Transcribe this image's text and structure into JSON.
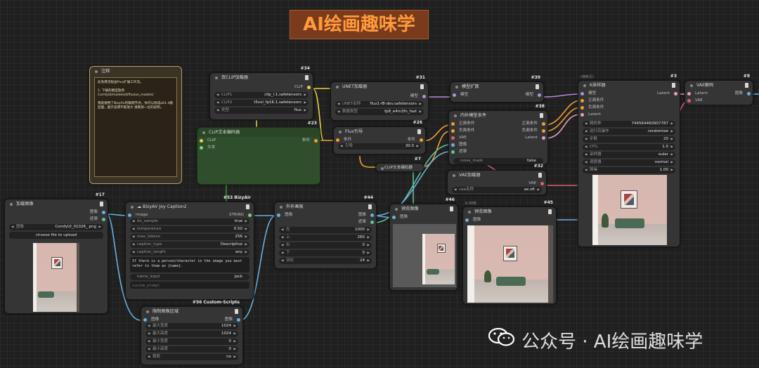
{
  "banner": {
    "title": "AI绘画趣味学"
  },
  "watermark": {
    "text": "公众号 · AI绘画趣味学"
  },
  "note": {
    "title": "注释",
    "lines": [
      "此免费流程由Flux扩展工作流。",
      "1. 下载的模型放到",
      "ComfyUI/models/diffusion_models/",
      "我就要用了BizyAir的联网节点，你可以改成a01.4模",
      "型图，图示说明不能放大 请看测一位的说明。"
    ]
  },
  "dual_clip": {
    "title": "双CLIP加载器",
    "id": "#34",
    "out": "CLIP",
    "w": [
      {
        "k": "CLIP1",
        "v": "clip_l.1.safetensors"
      },
      {
        "k": "CLIP2",
        "v": "t5xxl_fp16.1.safetensors"
      },
      {
        "k": "类型",
        "v": "flux"
      }
    ]
  },
  "unet": {
    "title": "UNET加载器",
    "id": "#31",
    "out": "模型",
    "w": [
      {
        "k": "UNET名称",
        "v": "flux1-f8-dev.safetensors"
      },
      {
        "k": "数据类型",
        "v": "fp8_e4m3fn_fast"
      }
    ]
  },
  "model_sampler": {
    "title": "模型扩散",
    "id": "#39",
    "in": "模型",
    "out": "模型"
  },
  "inpaint_cond": {
    "title": "内补模型条件",
    "id": "#38",
    "ins": [
      "正面条件",
      "负面条件",
      "VAE",
      "图像",
      "遮罩"
    ],
    "outs": [
      "正面条件",
      "负面条件",
      "Latent"
    ],
    "w": [
      {
        "k": "noise_mask",
        "v": "false"
      }
    ]
  },
  "ksampler": {
    "title": "K采样器",
    "id": "#3",
    "label_above": "(待执行)",
    "ins": [
      "模型",
      "正面条件",
      "负面条件",
      "Latent"
    ],
    "out": "Latent",
    "w": [
      {
        "k": "随机种",
        "v": "744564460907787"
      },
      {
        "k": "运行后操作",
        "v": "randomize"
      },
      {
        "k": "步数",
        "v": "20"
      },
      {
        "k": "CFG",
        "v": "1.0"
      },
      {
        "k": "采样器",
        "v": "euler"
      },
      {
        "k": "调度器",
        "v": "normal"
      },
      {
        "k": "降噪",
        "v": "1.00"
      }
    ]
  },
  "vae_decode": {
    "title": "VAE解码",
    "id": "#8",
    "ins": [
      "Latent",
      "VAE"
    ],
    "out": "图像"
  },
  "clip_encode": {
    "title": "CLIP文本编码器",
    "id": "#23",
    "ins": [
      "CLIP",
      "文本"
    ],
    "out": "条件"
  },
  "flux_guide": {
    "title": "Flux引导",
    "id": "#26",
    "in": "条件",
    "out": "条件",
    "w": [
      {
        "k": "引导",
        "v": "30.0"
      }
    ]
  },
  "clip_encode2": {
    "title": "CLIP文本编码器",
    "id": "#7"
  },
  "vae_loader": {
    "title": "VAE加载器",
    "id": "#32",
    "out": "VAE",
    "w": [
      {
        "k": "vae名称",
        "v": "ae.sft"
      }
    ]
  },
  "load_image": {
    "title": "加载图像",
    "id": "#17",
    "outs": [
      "图像",
      "遮罩"
    ],
    "w": [
      {
        "k": "图像",
        "v": "ComfyUI_01026_.png"
      }
    ],
    "upload": "choose file to upload"
  },
  "joy_caption": {
    "title": "☁ BizyAir Joy Caption2",
    "id": "#53 BizyAir",
    "in": "image",
    "out": "STRING",
    "w": [
      {
        "k": "do_sample",
        "v": "true"
      },
      {
        "k": "temperature",
        "v": "0.50"
      },
      {
        "k": "max_tokens",
        "v": "256"
      },
      {
        "k": "caption_type",
        "v": "Descriptive"
      },
      {
        "k": "caption_length",
        "v": "any"
      }
    ],
    "prompt_text": "If there is a person/character in the image you must refer to them as {name}.",
    "name_input": {
      "k": "name_input",
      "v": "Jack"
    },
    "custom_prompt": "custom_prompt"
  },
  "pad_image": {
    "title": "外补画板",
    "id": "#44",
    "in": "图像",
    "outs": [
      "图像",
      "遮罩"
    ],
    "w": [
      {
        "k": "左",
        "v": "1000"
      },
      {
        "k": "上",
        "v": "260"
      },
      {
        "k": "右",
        "v": "0"
      },
      {
        "k": "下",
        "v": "0"
      },
      {
        "k": "羽化",
        "v": "24"
      }
    ]
  },
  "preview1": {
    "title": "预览图像",
    "id": "#46",
    "in": "图像"
  },
  "preview2": {
    "title": "预览图像",
    "id": "#45",
    "in": "图像",
    "timer": "0.00秒"
  },
  "limit_image": {
    "title": "限制图像区域",
    "id": "#56 Custom-Scripts",
    "in": "图像",
    "out": "图像",
    "w": [
      {
        "k": "最大宽度",
        "v": "1024"
      },
      {
        "k": "最大高度",
        "v": "1024"
      },
      {
        "k": "最小宽度",
        "v": "0"
      },
      {
        "k": "最小高度",
        "v": "0"
      },
      {
        "k": "裁剪",
        "v": "no"
      }
    ]
  },
  "colors": {
    "clip": "#e8d24a",
    "model": "#b48ed8",
    "cond": "#f0a030",
    "vae": "#e06070",
    "image": "#6ab0e0",
    "latent": "#e8a0c0",
    "mask": "#5fc0a0",
    "green": "#2f4f2c"
  }
}
